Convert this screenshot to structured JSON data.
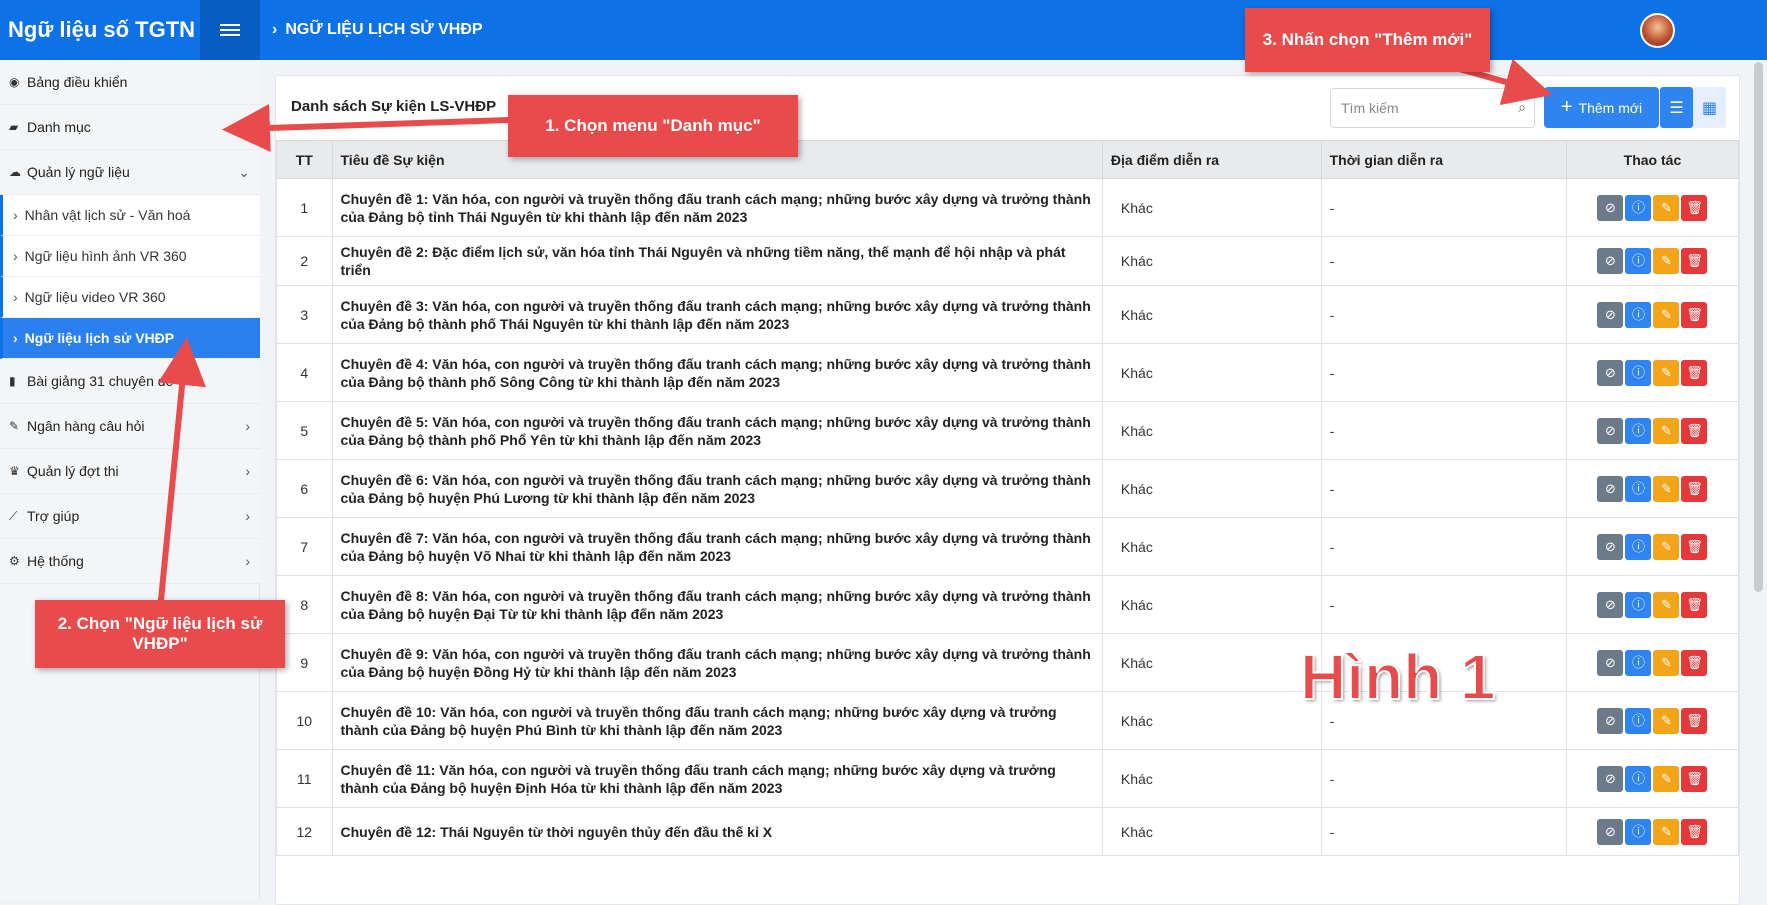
{
  "brand": {
    "title": "Ngữ liệu số TGTN"
  },
  "breadcrumb": {
    "current": "NGỮ LIỆU LỊCH SỬ VHĐP"
  },
  "sidebar": {
    "items": [
      {
        "label": "Bảng điều khiển",
        "icon": "dashboard-icon"
      },
      {
        "label": "Danh mục",
        "icon": "folder-icon"
      },
      {
        "label": "Quản lý ngữ liệu",
        "icon": "cloud-icon"
      }
    ],
    "subitems": [
      {
        "label": "Nhân vật lịch sử - Văn hoá"
      },
      {
        "label": "Ngữ liệu hình ảnh VR 360"
      },
      {
        "label": "Ngữ liệu video VR 360"
      },
      {
        "label": "Ngữ liệu lịch sử VHĐP"
      }
    ],
    "items2": [
      {
        "label": "Bài giảng 31 chuyên đề",
        "icon": "book-icon"
      },
      {
        "label": "Ngân hàng câu hỏi",
        "icon": "edit-icon"
      },
      {
        "label": "Quản lý đợt thi",
        "icon": "trophy-icon"
      },
      {
        "label": "Trợ giúp",
        "icon": "chart-icon"
      },
      {
        "label": "Hệ thống",
        "icon": "cogs-icon"
      }
    ]
  },
  "card": {
    "title": "Danh sách Sự kiện LS-VHĐP",
    "search_placeholder": "Tìm kiếm",
    "add_label": "Thêm mới"
  },
  "table": {
    "headers": {
      "tt": "TT",
      "title": "Tiêu đề Sự kiện",
      "place": "Địa điểm diễn ra",
      "time": "Thời gian diễn ra",
      "actions": "Thao tác"
    },
    "rows": [
      {
        "tt": "1",
        "title": "Chuyên đề 1: Văn hóa, con người và truyền thống đấu tranh cách mạng; những bước xây dựng và trưởng thành của Đảng bộ tỉnh Thái Nguyên từ khi thành lập đến năm 2023",
        "place": "Khác",
        "time": "-"
      },
      {
        "tt": "2",
        "title": "Chuyên đề 2: Đặc điểm lịch sử, văn hóa tỉnh Thái Nguyên và những tiềm năng, thế mạnh để hội nhập và phát triển",
        "place": "Khác",
        "time": "-"
      },
      {
        "tt": "3",
        "title": "Chuyên đề 3: Văn hóa, con người và truyền thống đấu tranh cách mạng; những bước xây dựng và trưởng thành của Đảng bộ thành phố Thái Nguyên từ khi thành lập đến năm 2023",
        "place": "Khác",
        "time": "-"
      },
      {
        "tt": "4",
        "title": "Chuyên đề 4: Văn hóa, con người và truyền thống đấu tranh cách mạng; những bước xây dựng và trưởng thành của Đảng bộ thành phố Sông Công từ khi thành lập đến năm 2023",
        "place": "Khác",
        "time": "-"
      },
      {
        "tt": "5",
        "title": "Chuyên đề 5: Văn hóa, con người và truyền thống đấu tranh cách mạng; những bước xây dựng và trưởng thành của Đảng bộ thành phố Phổ Yên từ khi thành lập đến năm 2023",
        "place": "Khác",
        "time": "-"
      },
      {
        "tt": "6",
        "title": "Chuyên đề 6: Văn hóa, con người và truyền thống đấu tranh cách mạng; những bước xây dựng và trưởng thành của Đảng bộ huyện Phú Lương từ khi thành lập đến năm 2023",
        "place": "Khác",
        "time": "-"
      },
      {
        "tt": "7",
        "title": "Chuyên đề 7: Văn hóa, con người và truyền thống đấu tranh cách mạng; những bước xây dựng và trưởng thành của Đảng bộ huyện Võ Nhai từ khi thành lập đến năm 2023",
        "place": "Khác",
        "time": "-"
      },
      {
        "tt": "8",
        "title": "Chuyên đề 8: Văn hóa, con người và truyền thống đấu tranh cách mạng; những bước xây dựng và trưởng thành của Đảng bộ huyện Đại Từ từ khi thành lập đến năm 2023",
        "place": "Khác",
        "time": "-"
      },
      {
        "tt": "9",
        "title": "Chuyên đề 9: Văn hóa, con người và truyền thống đấu tranh cách mạng; những bước xây dựng và trưởng thành của Đảng bộ huyện Đồng Hỷ từ khi thành lập đến năm 2023",
        "place": "Khác",
        "time": ""
      },
      {
        "tt": "10",
        "title": "Chuyên đề 10: Văn hóa, con người và truyền thống đấu tranh cách mạng; những bước xây dựng và trưởng thành của Đảng bộ huyện Phú Bình từ khi thành lập đến năm 2023",
        "place": "Khác",
        "time": "-"
      },
      {
        "tt": "11",
        "title": "Chuyên đề 11: Văn hóa, con người và truyền thống đấu tranh cách mạng; những bước xây dựng và trưởng thành của Đảng bộ huyện Định Hóa từ khi thành lập đến năm 2023",
        "place": "Khác",
        "time": "-"
      },
      {
        "tt": "12",
        "title": "Chuyên đề 12: Thái Nguyên từ thời nguyên thủy đến đầu thế kỉ X",
        "place": "Khác",
        "time": "-"
      }
    ]
  },
  "annotations": {
    "step1": "1. Chọn menu \"Danh mục\"",
    "step2": "2. Chọn \"Ngữ liệu lịch sử VHĐP\"",
    "step3": "3. Nhấn chọn \"Thêm mới\"",
    "figure": "Hình 1"
  },
  "colors": {
    "primary": "#0d72e8",
    "callout": "#e84b4b"
  }
}
